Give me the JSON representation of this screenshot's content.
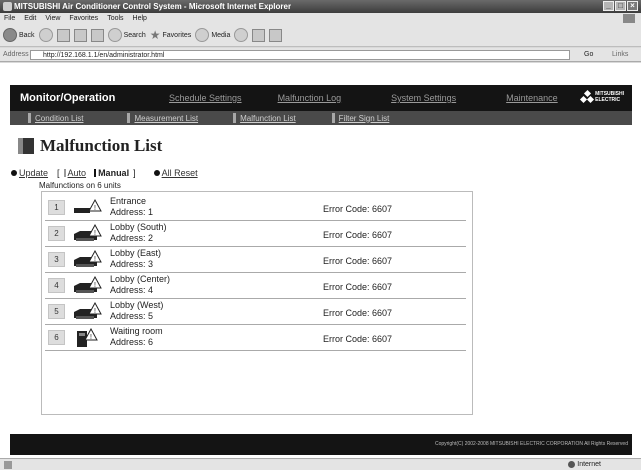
{
  "window": {
    "title": "MITSUBISHI Air Conditioner Control System - Microsoft Internet Explorer"
  },
  "menu": [
    "File",
    "Edit",
    "View",
    "Favorites",
    "Tools",
    "Help"
  ],
  "toolbar": {
    "back_label": "Back",
    "search_label": "Search",
    "favorites_label": "Favorites",
    "media_label": "Media"
  },
  "address": {
    "label": "Address",
    "url": "http://192.168.1.1/en/administrator.html",
    "go_label": "Go",
    "links_label": "Links"
  },
  "nav": {
    "brand": "Monitor/Operation",
    "links": [
      "Schedule Settings",
      "Malfunction Log",
      "System Settings",
      "Maintenance"
    ],
    "logo_text_1": "MITSUBISHI",
    "logo_text_2": "ELECTRIC"
  },
  "subnav": [
    "Condition List",
    "Measurement List",
    "Malfunction List",
    "Filter Sign List"
  ],
  "page": {
    "title": "Malfunction List",
    "update_label": "Update",
    "bracket_open": "[",
    "auto_label": "Auto",
    "manual_label": "Manual",
    "bracket_close": "]",
    "all_reset_label": "All Reset",
    "count_text": "Malfunctions on 6 units"
  },
  "malfunctions": [
    {
      "num": "1",
      "name": "Entrance",
      "address": "Address: 1",
      "error": "Error Code: 6607",
      "unit_type": "wall-mounted-unit-icon"
    },
    {
      "num": "2",
      "name": "Lobby (South)",
      "address": "Address: 2",
      "error": "Error Code: 6607",
      "unit_type": "cassette-unit-icon"
    },
    {
      "num": "3",
      "name": "Lobby (East)",
      "address": "Address: 3",
      "error": "Error Code: 6607",
      "unit_type": "cassette-unit-icon"
    },
    {
      "num": "4",
      "name": "Lobby (Center)",
      "address": "Address: 4",
      "error": "Error Code: 6607",
      "unit_type": "cassette-unit-icon"
    },
    {
      "num": "5",
      "name": "Lobby (West)",
      "address": "Address: 5",
      "error": "Error Code: 6607",
      "unit_type": "cassette-unit-icon"
    },
    {
      "num": "6",
      "name": "Waiting room",
      "address": "Address: 6",
      "error": "Error Code: 6607",
      "unit_type": "floor-standing-unit-icon"
    }
  ],
  "footer": {
    "copyright": "Copyright(C) 2002-2008 MITSUBISHI ELECTRIC CORPORATION All Rights Reserved"
  },
  "status": {
    "zone": "Internet"
  }
}
